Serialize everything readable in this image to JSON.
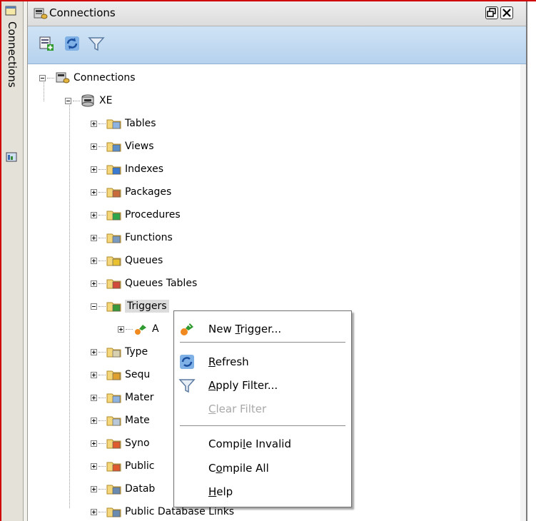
{
  "panel": {
    "title": "Connections",
    "dock_tab_label": "Connections"
  },
  "tree": {
    "root_label": "Connections",
    "connection_label": "XE",
    "nodes": [
      {
        "label": "Tables",
        "icon": "tables-folder-icon"
      },
      {
        "label": "Views",
        "icon": "views-folder-icon"
      },
      {
        "label": "Indexes",
        "icon": "indexes-folder-icon"
      },
      {
        "label": "Packages",
        "icon": "packages-folder-icon"
      },
      {
        "label": "Procedures",
        "icon": "procedures-folder-icon"
      },
      {
        "label": "Functions",
        "icon": "functions-folder-icon"
      },
      {
        "label": "Queues",
        "icon": "queues-folder-icon"
      },
      {
        "label": "Queues Tables",
        "icon": "queues-tables-folder-icon"
      },
      {
        "label": "Triggers",
        "icon": "triggers-folder-icon"
      },
      {
        "label": "A",
        "icon": "trigger-item-icon"
      },
      {
        "label": "Type",
        "icon": "types-folder-icon"
      },
      {
        "label": "Sequ",
        "icon": "sequences-folder-icon"
      },
      {
        "label": "Mater",
        "icon": "materialized-views-folder-icon"
      },
      {
        "label": "Mate",
        "icon": "materialized-view-logs-folder-icon"
      },
      {
        "label": "Syno",
        "icon": "synonyms-folder-icon"
      },
      {
        "label": "Public",
        "icon": "public-synonyms-folder-icon"
      },
      {
        "label": "Datab",
        "icon": "database-links-folder-icon"
      },
      {
        "label": "Public Database Links",
        "icon": "public-database-links-folder-icon"
      }
    ]
  },
  "context_menu": {
    "items": [
      {
        "pre": "New ",
        "mn": "T",
        "post": "rigger...",
        "enabled": true
      },
      {
        "pre": "",
        "mn": "R",
        "post": "efresh",
        "enabled": true
      },
      {
        "pre": "",
        "mn": "A",
        "post": "pply Filter...",
        "enabled": true
      },
      {
        "pre": "",
        "mn": "C",
        "post": "lear Filter",
        "enabled": false
      },
      {
        "pre": "Compi",
        "mn": "l",
        "post": "e Invalid",
        "enabled": true
      },
      {
        "pre": "C",
        "mn": "o",
        "post": "mpile All",
        "enabled": true
      },
      {
        "pre": "",
        "mn": "H",
        "post": "elp",
        "enabled": true
      }
    ]
  },
  "colors": {
    "toolbar_blue": "#c4dcf2",
    "window_frame_red": "#d00000",
    "disabled_text": "#a8a8a8"
  }
}
